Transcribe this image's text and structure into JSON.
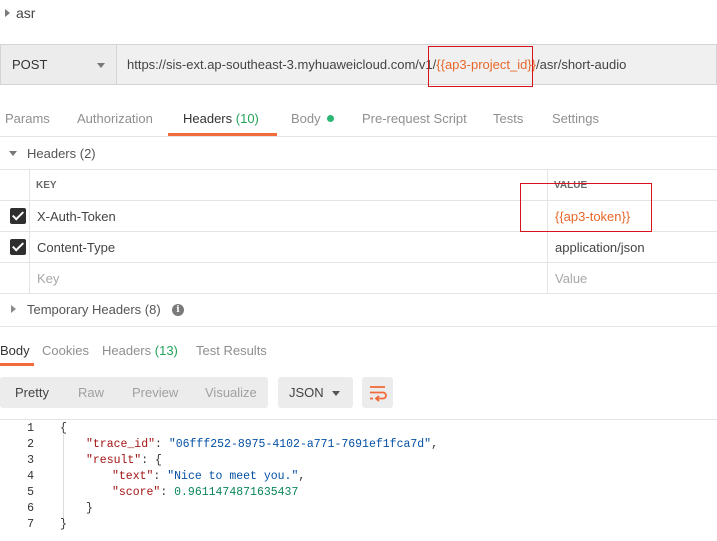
{
  "collection": {
    "name": "asr"
  },
  "request": {
    "method": "POST",
    "url_prefix": "https://sis-ext.ap-southeast-3.myhuaweicloud.com/v1/",
    "url_variable": "{{ap3-project_id}}",
    "url_suffix": "/asr/short-audio"
  },
  "request_tabs": {
    "params": "Params",
    "authorization": "Authorization",
    "headers": "Headers",
    "headers_count": "(10)",
    "body": "Body",
    "pre_request": "Pre-request Script",
    "tests": "Tests",
    "settings": "Settings"
  },
  "headers_section": {
    "title": "Headers (2)",
    "col_key": "KEY",
    "col_value": "VALUE",
    "rows": [
      {
        "key": "X-Auth-Token",
        "value": "{{ap3-token}}",
        "checked": true
      },
      {
        "key": "Content-Type",
        "value": "application/json",
        "checked": true
      }
    ],
    "placeholder_key": "Key",
    "placeholder_value": "Value"
  },
  "temp_headers": {
    "title": "Temporary Headers (8)"
  },
  "response_tabs": {
    "body": "Body",
    "cookies": "Cookies",
    "headers": "Headers",
    "headers_count": "(13)",
    "test_results": "Test Results"
  },
  "view_modes": {
    "pretty": "Pretty",
    "raw": "Raw",
    "preview": "Preview",
    "visualize": "Visualize"
  },
  "language": "JSON",
  "response_body": {
    "line_numbers": [
      "1",
      "2",
      "3",
      "4",
      "5",
      "6",
      "7"
    ],
    "open_brace": "{",
    "trace_key": "\"trace_id\"",
    "trace_value": "\"06fff252-8975-4102-a771-7691ef1fca7d\"",
    "result_key": "\"result\"",
    "result_open": "{",
    "text_key": "\"text\"",
    "text_value": "\"Nice to meet you.\"",
    "score_key": "\"score\"",
    "score_value": "0.9611474871635437",
    "inner_close": "}",
    "close_brace": "}"
  },
  "colors": {
    "accent": "#f26b3a",
    "variable": "#e8672a",
    "count": "#23a35a",
    "annotation": "#d9111a"
  }
}
